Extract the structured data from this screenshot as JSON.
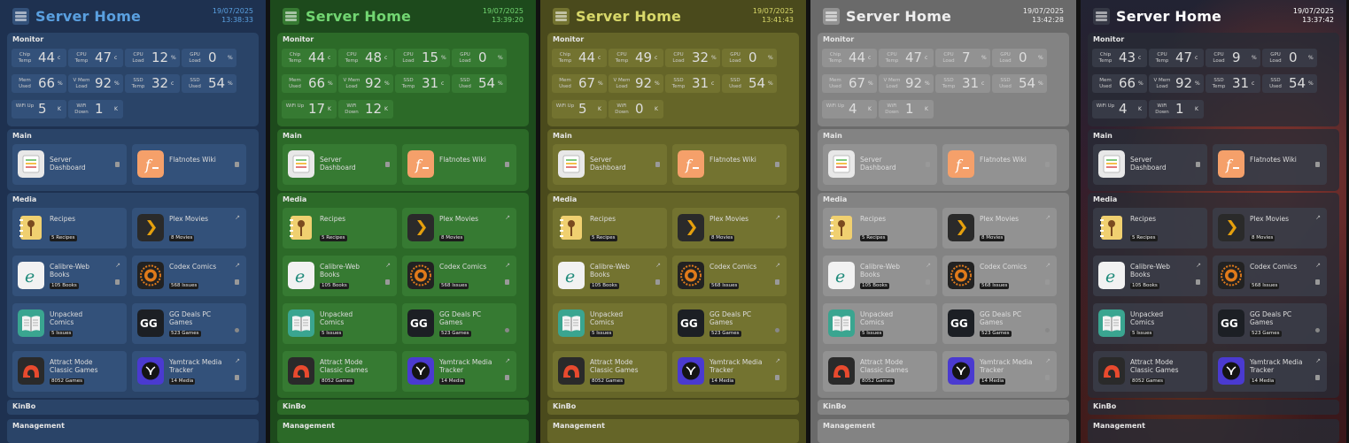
{
  "app_title": "Server Home",
  "date": "19/07/2025",
  "sections": {
    "monitor": "Monitor",
    "main": "Main",
    "media": "Media",
    "kinbo": "KinBo",
    "management": "Management"
  },
  "variants": [
    {
      "theme": "blue",
      "time": "13:38:33",
      "accent": "#5aa0e0",
      "stats": [
        {
          "label": "Chip Temp",
          "value": "44",
          "unit": "c"
        },
        {
          "label": "CPU Temp",
          "value": "47",
          "unit": "c"
        },
        {
          "label": "CPU Load",
          "value": "12",
          "unit": "%"
        },
        {
          "label": "GPU Load",
          "value": "0",
          "unit": "%"
        },
        {
          "label": "Mem Used",
          "value": "66",
          "unit": "%"
        },
        {
          "label": "V Mem Load",
          "value": "92",
          "unit": "%"
        },
        {
          "label": "SSD Temp",
          "value": "32",
          "unit": "c"
        },
        {
          "label": "SSD Used",
          "value": "54",
          "unit": "%"
        },
        {
          "label": "WiFi Up",
          "value": "5",
          "unit": "K"
        },
        {
          "label": "WiFi Down",
          "value": "1",
          "unit": "K"
        }
      ]
    },
    {
      "theme": "green",
      "time": "13:39:20",
      "accent": "#72d672",
      "stats": [
        {
          "label": "Chip Temp",
          "value": "44",
          "unit": "c"
        },
        {
          "label": "CPU Temp",
          "value": "48",
          "unit": "c"
        },
        {
          "label": "CPU Load",
          "value": "15",
          "unit": "%"
        },
        {
          "label": "GPU Load",
          "value": "0",
          "unit": "%"
        },
        {
          "label": "Mem Used",
          "value": "66",
          "unit": "%"
        },
        {
          "label": "V Mem Load",
          "value": "92",
          "unit": "%"
        },
        {
          "label": "SSD Temp",
          "value": "31",
          "unit": "c"
        },
        {
          "label": "SSD Used",
          "value": "54",
          "unit": "%"
        },
        {
          "label": "WiFi Up",
          "value": "17",
          "unit": "K"
        },
        {
          "label": "WiFi Down",
          "value": "12",
          "unit": "K"
        }
      ]
    },
    {
      "theme": "olive",
      "time": "13:41:43",
      "accent": "#d8d86a",
      "stats": [
        {
          "label": "Chip Temp",
          "value": "44",
          "unit": "c"
        },
        {
          "label": "CPU Temp",
          "value": "49",
          "unit": "c"
        },
        {
          "label": "CPU Load",
          "value": "32",
          "unit": "%"
        },
        {
          "label": "GPU Load",
          "value": "0",
          "unit": "%"
        },
        {
          "label": "Mem Used",
          "value": "67",
          "unit": "%"
        },
        {
          "label": "V Mem Load",
          "value": "92",
          "unit": "%"
        },
        {
          "label": "SSD Temp",
          "value": "31",
          "unit": "c"
        },
        {
          "label": "SSD Used",
          "value": "54",
          "unit": "%"
        },
        {
          "label": "WiFi Up",
          "value": "5",
          "unit": "K"
        },
        {
          "label": "WiFi Down",
          "value": "0",
          "unit": "K"
        }
      ]
    },
    {
      "theme": "gray",
      "time": "13:42:28",
      "accent": "#eeeeee",
      "stats": [
        {
          "label": "Chip Temp",
          "value": "44",
          "unit": "c"
        },
        {
          "label": "CPU Temp",
          "value": "47",
          "unit": "c"
        },
        {
          "label": "CPU Load",
          "value": "7",
          "unit": "%"
        },
        {
          "label": "GPU Load",
          "value": "0",
          "unit": "%"
        },
        {
          "label": "Mem Used",
          "value": "67",
          "unit": "%"
        },
        {
          "label": "V Mem Load",
          "value": "92",
          "unit": "%"
        },
        {
          "label": "SSD Temp",
          "value": "31",
          "unit": "c"
        },
        {
          "label": "SSD Used",
          "value": "54",
          "unit": "%"
        },
        {
          "label": "WiFi Up",
          "value": "4",
          "unit": "K"
        },
        {
          "label": "WiFi Down",
          "value": "1",
          "unit": "K"
        }
      ]
    },
    {
      "theme": "dark",
      "time": "13:37:42",
      "accent": "#ffffff",
      "stats": [
        {
          "label": "Chip Temp",
          "value": "43",
          "unit": "c"
        },
        {
          "label": "CPU Temp",
          "value": "47",
          "unit": "c"
        },
        {
          "label": "CPU Load",
          "value": "9",
          "unit": "%"
        },
        {
          "label": "GPU Load",
          "value": "0",
          "unit": "%"
        },
        {
          "label": "Mem Used",
          "value": "66",
          "unit": "%"
        },
        {
          "label": "V Mem Load",
          "value": "92",
          "unit": "%"
        },
        {
          "label": "SSD Temp",
          "value": "31",
          "unit": "c"
        },
        {
          "label": "SSD Used",
          "value": "54",
          "unit": "%"
        },
        {
          "label": "WiFi Up",
          "value": "4",
          "unit": "K"
        },
        {
          "label": "WiFi Down",
          "value": "1",
          "unit": "K"
        }
      ]
    }
  ],
  "main_tiles": [
    {
      "name": "Server Dashboard",
      "icon": "dashboard-icon",
      "marker": "square"
    },
    {
      "name": "Flatnotes Wiki",
      "icon": "flatnotes-icon",
      "marker": "square"
    }
  ],
  "media_tiles": [
    {
      "name": "Recipes",
      "badge": "5 Recipes",
      "icon": "recipe-book-icon",
      "marker": "none"
    },
    {
      "name": "Plex Movies",
      "badge": "8 Movies",
      "icon": "plex-icon",
      "marker": "ext"
    },
    {
      "name": "Calibre-Web Books",
      "badge": "105 Books",
      "icon": "calibre-icon",
      "marker": "ext-square"
    },
    {
      "name": "Codex Comics",
      "badge": "568 Issues",
      "icon": "codex-icon",
      "marker": "ext-square"
    },
    {
      "name": "Unpacked Comics",
      "badge": "5 Issues",
      "icon": "unpacked-comics-icon",
      "marker": "none"
    },
    {
      "name": "GG Deals PC Games",
      "badge": "523 Games",
      "icon": "gg-deals-icon",
      "marker": "dot"
    },
    {
      "name": "Attract Mode Classic Games",
      "badge": "8052 Games",
      "icon": "attract-mode-icon",
      "marker": "none"
    },
    {
      "name": "Yamtrack Media Tracker",
      "badge": "14 Media",
      "icon": "yamtrack-icon",
      "marker": "ext-square"
    }
  ],
  "colors": {
    "blue": {
      "bg": "#1e3150",
      "sec": "#2a4468",
      "box": "#33517a"
    },
    "green": {
      "bg": "#1d4a1c",
      "sec": "#2c6a28",
      "box": "#367a32"
    },
    "olive": {
      "bg": "#4a4a1c",
      "sec": "#656528",
      "box": "#737330"
    },
    "gray": {
      "bg": "#6a6a6a",
      "sec": "#838383",
      "box": "#929292"
    },
    "dark": {
      "bg": "#22252c",
      "sec": "rgba(40,44,54,0.78)",
      "box": "rgba(60,64,76,0.75)"
    }
  }
}
